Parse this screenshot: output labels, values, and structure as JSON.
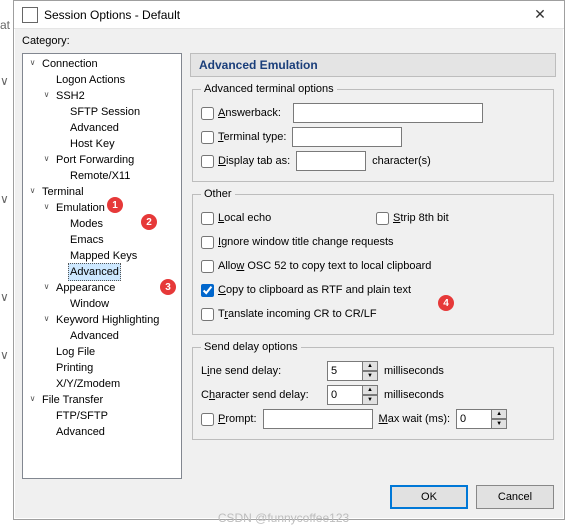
{
  "window": {
    "title": "Session Options - Default",
    "close_icon": "✕"
  },
  "layout": {
    "category_label": "Category:"
  },
  "tree": {
    "connection": "Connection",
    "logon_actions": "Logon Actions",
    "ssh2": "SSH2",
    "sftp_session": "SFTP Session",
    "ssh2_advanced": "Advanced",
    "host_key": "Host Key",
    "port_forwarding": "Port Forwarding",
    "remote_x11": "Remote/X11",
    "terminal": "Terminal",
    "emulation": "Emulation",
    "modes": "Modes",
    "emacs": "Emacs",
    "mapped_keys": "Mapped Keys",
    "emu_advanced": "Advanced",
    "appearance": "Appearance",
    "window": "Window",
    "keyword_highlighting": "Keyword Highlighting",
    "kh_advanced": "Advanced",
    "log_file": "Log File",
    "printing": "Printing",
    "xyz": "X/Y/Zmodem",
    "file_transfer": "File Transfer",
    "ftp_sftp": "FTP/SFTP",
    "ft_advanced": "Advanced"
  },
  "right": {
    "heading": "Advanced Emulation",
    "group_adv": "Advanced terminal options",
    "answerback": "Answerback:",
    "terminal_type": "Terminal type:",
    "display_tab": "Display tab as:",
    "characters": "character(s)",
    "group_other": "Other",
    "local_echo": "Local echo",
    "strip_8th": "Strip 8th bit",
    "ignore_title": "Ignore window title change requests",
    "allow_osc52": "Allow OSC 52 to copy text to local clipboard",
    "copy_rtf": "Copy to clipboard as RTF and plain text",
    "translate_cr": "Translate incoming CR to CR/LF",
    "group_delay": "Send delay options",
    "line_delay": "Line send delay:",
    "char_delay": "Character send delay:",
    "ms": "milliseconds",
    "prompt": "Prompt:",
    "max_wait": "Max wait (ms):",
    "line_delay_val": "5",
    "char_delay_val": "0",
    "max_wait_val": "0"
  },
  "buttons": {
    "ok": "OK",
    "cancel": "Cancel"
  },
  "annotations": {
    "a1": "1",
    "a2": "2",
    "a3": "3",
    "a4": "4"
  },
  "watermark": "CSDN @funnycoffee123"
}
